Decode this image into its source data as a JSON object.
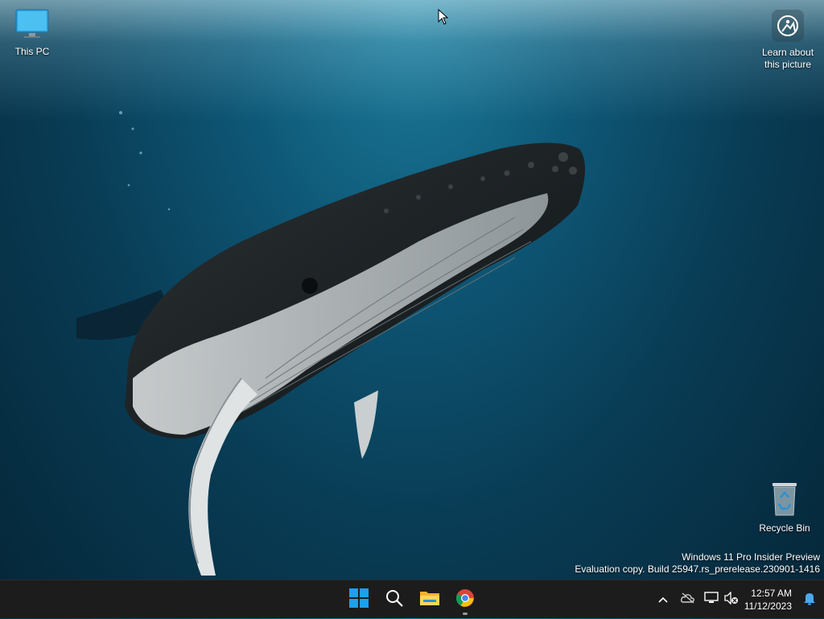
{
  "desktop": {
    "icons": [
      {
        "label": "This PC",
        "icon": "monitor-icon"
      },
      {
        "label": "Recycle Bin",
        "icon": "recycle-bin-icon"
      }
    ],
    "spotlight": {
      "label_line1": "Learn about",
      "label_line2": "this picture",
      "icon": "camera-lens-icon"
    },
    "watermark": {
      "line1": "Windows 11 Pro Insider Preview",
      "line2": "Evaluation copy. Build 25947.rs_prerelease.230901-1416"
    }
  },
  "taskbar": {
    "apps": [
      {
        "name": "Start",
        "icon": "windows-start-icon"
      },
      {
        "name": "Search",
        "icon": "search-icon"
      },
      {
        "name": "File Explorer",
        "icon": "folder-icon"
      },
      {
        "name": "Google Chrome",
        "icon": "chrome-icon",
        "running": true
      }
    ],
    "tray": {
      "icons": [
        "chevron-up-icon",
        "onedrive-offline-icon",
        "network-icon",
        "volume-muted-icon",
        "notification-bell-icon"
      ],
      "time": "12:57 AM",
      "date": "11/12/2023"
    }
  },
  "colors": {
    "taskbar_bg": "#1c1c1c",
    "accent_blue": "#0078d4",
    "ocean_dark": "#052638",
    "ocean_light": "#1f7f9e"
  }
}
